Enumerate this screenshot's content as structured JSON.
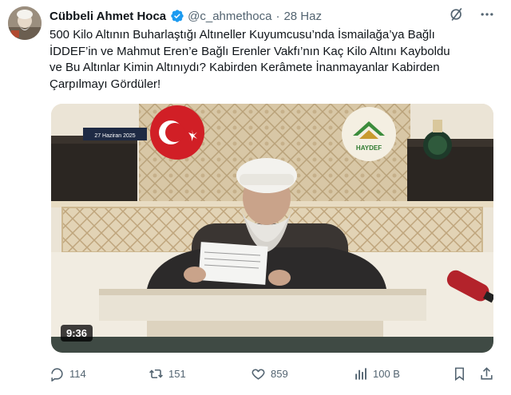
{
  "tweet": {
    "author_name": "Cübbeli Ahmet Hoca",
    "handle": "@c_ahmethoca",
    "separator": "·",
    "date": "28 Haz",
    "text_lines": [
      "500 Kilo Altının Buharlaştığı Altıneller  Kuyumcusu’nda İsmailağa’ya Bağlı",
      "İDDEF’in ve Mahmut Eren’e Bağlı Erenler Vakfı’nın Kaç Kilo Altını Kayboldu",
      "ve Bu Altınlar Kimin Altınıydı? Kabirden Kerâmete İnanmayanlar Kabirden",
      "Çarpılmayı Gördüler!"
    ]
  },
  "media": {
    "video_date_label": "27 Haziran 2025",
    "logo_text": "HAYDEF",
    "duration": "9:36"
  },
  "actions": {
    "replies": "114",
    "retweets": "151",
    "likes": "859",
    "views": "100 B"
  },
  "colors": {
    "verified": "#1d9bf0",
    "muted": "#536471",
    "text": "#0f1419"
  }
}
